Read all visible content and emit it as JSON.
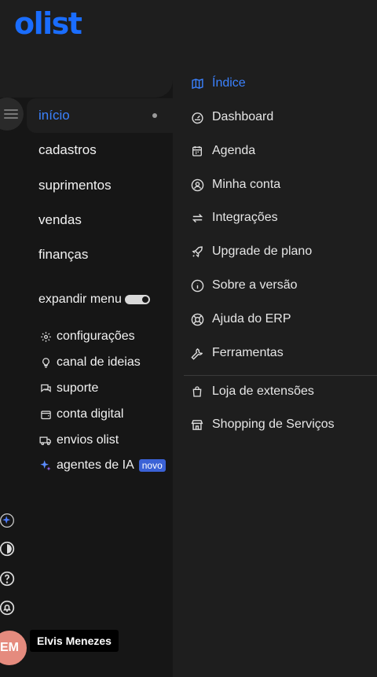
{
  "brand": {
    "logo_text": "olist",
    "logo_color": "#1a6dff"
  },
  "nav": {
    "items": [
      {
        "label": "início",
        "active": true
      },
      {
        "label": "cadastros"
      },
      {
        "label": "suprimentos"
      },
      {
        "label": "vendas"
      },
      {
        "label": "finanças"
      }
    ],
    "expand_label": "expandir menu",
    "expand_on": true
  },
  "utilities": [
    {
      "label": "configurações",
      "icon": "gear-icon"
    },
    {
      "label": "canal de ideias",
      "icon": "lightbulb-icon"
    },
    {
      "label": "suporte",
      "icon": "chat-icon"
    },
    {
      "label": "conta digital",
      "icon": "wallet-icon"
    },
    {
      "label": "envios olist",
      "icon": "truck-icon"
    },
    {
      "label": "agentes de IA",
      "icon": "sparkle-icon",
      "badge": "novo"
    }
  ],
  "user": {
    "initials": "EM",
    "name": "Elvis Menezes"
  },
  "submenu": {
    "items": [
      {
        "label": "Índice",
        "icon": "map-icon",
        "active": true
      },
      {
        "label": "Dashboard",
        "icon": "gauge-icon"
      },
      {
        "label": "Agenda",
        "icon": "calendar-icon"
      },
      {
        "label": "Minha conta",
        "icon": "user-circle-icon"
      },
      {
        "label": "Integrações",
        "icon": "arrows-swap-icon"
      },
      {
        "label": "Upgrade de plano",
        "icon": "rocket-icon"
      },
      {
        "label": "Sobre a versão",
        "icon": "info-icon"
      },
      {
        "label": "Ajuda do ERP",
        "icon": "lifebuoy-icon"
      },
      {
        "label": "Ferramentas",
        "icon": "wrench-icon"
      }
    ],
    "extra_items": [
      {
        "label": "Loja de extensões",
        "icon": "shopping-bag-icon"
      },
      {
        "label": "Shopping de Serviços",
        "icon": "store-icon"
      }
    ]
  },
  "colors": {
    "accent": "#3b82ff",
    "badge": "#3b62d6",
    "avatar": "#e58b7e"
  }
}
